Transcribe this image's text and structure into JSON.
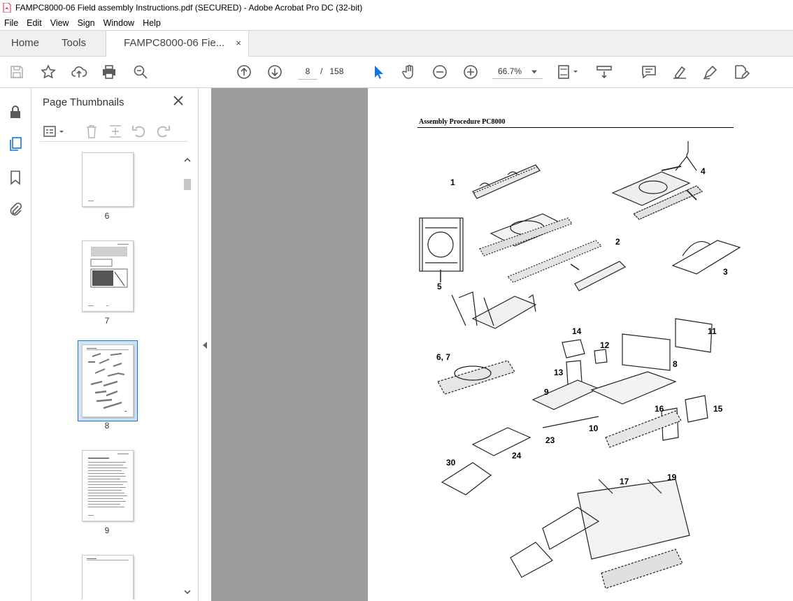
{
  "window": {
    "title": "FAMPC8000-06 Field assembly Instructions.pdf (SECURED) - Adobe Acrobat Pro DC (32-bit)",
    "app_icon": "acrobat-icon"
  },
  "menu": [
    "File",
    "Edit",
    "View",
    "Sign",
    "Window",
    "Help"
  ],
  "tabs": {
    "home": "Home",
    "tools": "Tools",
    "doc": "FAMPC8000-06 Fie...",
    "close": "×"
  },
  "toolbar": {
    "current_page": "8",
    "separator": "/",
    "total_pages": "158",
    "zoom": "66.7%"
  },
  "panel": {
    "title": "Page Thumbnails"
  },
  "thumbnails": [
    {
      "label": "6"
    },
    {
      "label": "7"
    },
    {
      "label": "8",
      "selected": true
    },
    {
      "label": "9"
    }
  ],
  "document": {
    "header": "Assembly Procedure PC8000",
    "callouts": [
      "1",
      "4",
      "2",
      "5",
      "3",
      "6, 7",
      "14",
      "12",
      "11",
      "13",
      "8",
      "9",
      "16",
      "15",
      "10",
      "23",
      "24",
      "30",
      "17",
      "19"
    ]
  },
  "colors": {
    "accent": "#1473e6",
    "icon": "#5a5a5a",
    "pdf_red": "#d7282f",
    "gray_bg": "#9b9b9b"
  }
}
